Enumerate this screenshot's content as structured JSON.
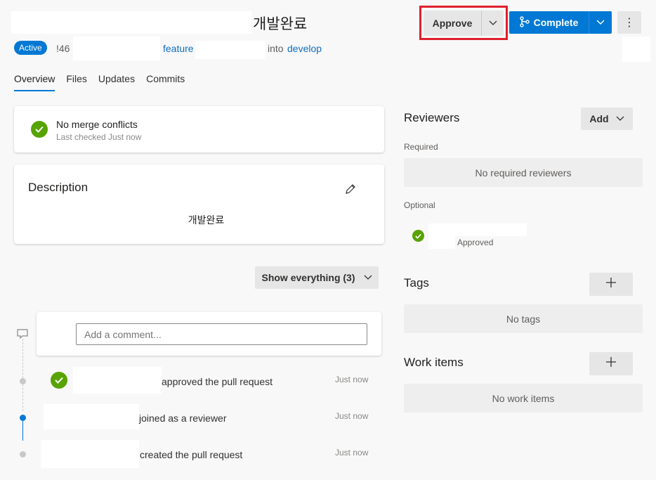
{
  "header": {
    "title": "개발완료",
    "approve_label": "Approve",
    "complete_label": "Complete",
    "status_badge": "Active",
    "pr_id": "!46",
    "source_branch": "feature",
    "into_text": "into",
    "target_branch": "develop"
  },
  "tabs": [
    {
      "label": "Overview",
      "active": true
    },
    {
      "label": "Files",
      "active": false
    },
    {
      "label": "Updates",
      "active": false
    },
    {
      "label": "Commits",
      "active": false
    }
  ],
  "merge": {
    "title": "No merge conflicts",
    "subtitle": "Last checked Just now"
  },
  "description": {
    "heading": "Description",
    "body": "개발완료"
  },
  "filter": {
    "label": "Show everything (3)"
  },
  "comment": {
    "placeholder": "Add a comment..."
  },
  "activity": [
    {
      "text": "approved the pull request",
      "time": "Just now"
    },
    {
      "text": "joined as a reviewer",
      "time": "Just now"
    },
    {
      "text": "created the pull request",
      "time": "Just now"
    }
  ],
  "reviewers": {
    "heading": "Reviewers",
    "add_label": "Add",
    "required_label": "Required",
    "required_empty": "No required reviewers",
    "optional_label": "Optional",
    "optional_status": "Approved"
  },
  "tags": {
    "heading": "Tags",
    "empty": "No tags"
  },
  "work_items": {
    "heading": "Work items",
    "empty": "No work items"
  },
  "colors": {
    "accent": "#0078d4",
    "success": "#57a300",
    "highlight_border": "#e0202d"
  }
}
